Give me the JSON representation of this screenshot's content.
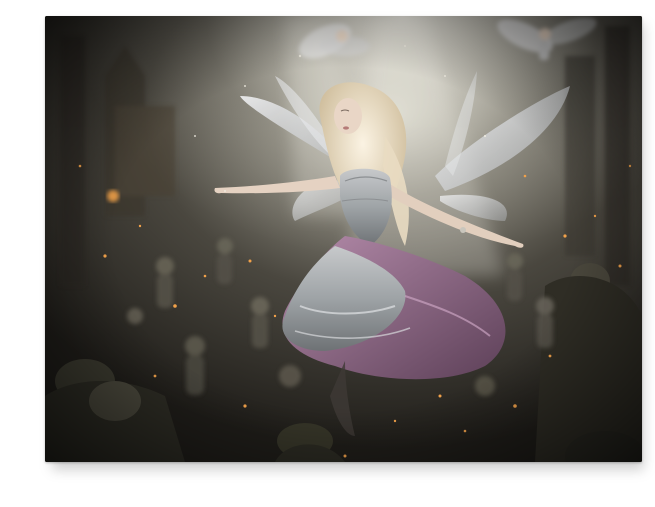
{
  "image": {
    "subject": "fairy-dancer-canvas-print",
    "palette": {
      "background": "#ffffff",
      "scene_dark": "#2e2b25",
      "scene_mid": "#5a574d",
      "glow": "#e8e6dc",
      "dress_silver": "#b9bcc0",
      "dress_lilac": "#9c7a96",
      "hair": "#efe4cf",
      "skin": "#e9d6c6",
      "wings": "#dfe2e6",
      "embers": "#f2a24a"
    }
  }
}
